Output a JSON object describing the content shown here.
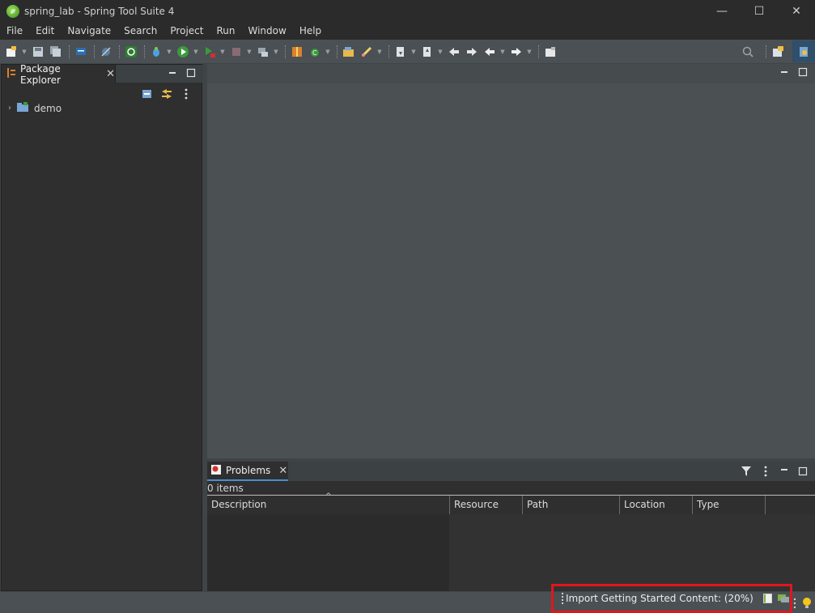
{
  "window": {
    "title": "spring_lab - Spring Tool Suite 4",
    "controls": {
      "minimize": "—",
      "maximize": "☐",
      "close": "✕"
    }
  },
  "menu": [
    "File",
    "Edit",
    "Navigate",
    "Search",
    "Project",
    "Run",
    "Window",
    "Help"
  ],
  "package_explorer": {
    "tab_label": "Package Explorer",
    "tree": [
      {
        "label": "demo",
        "expanded": false
      }
    ]
  },
  "problems": {
    "tab_label": "Problems",
    "items_count": "0 items",
    "columns": [
      "Description",
      "Resource",
      "Path",
      "Location",
      "Type"
    ]
  },
  "status": {
    "job_text": "Import Getting Started Content: (20%)",
    "progress_fraction": 0.2
  },
  "colors": {
    "accent_highlight": "#e0161d",
    "tab_underline": "#4a8fc9"
  }
}
